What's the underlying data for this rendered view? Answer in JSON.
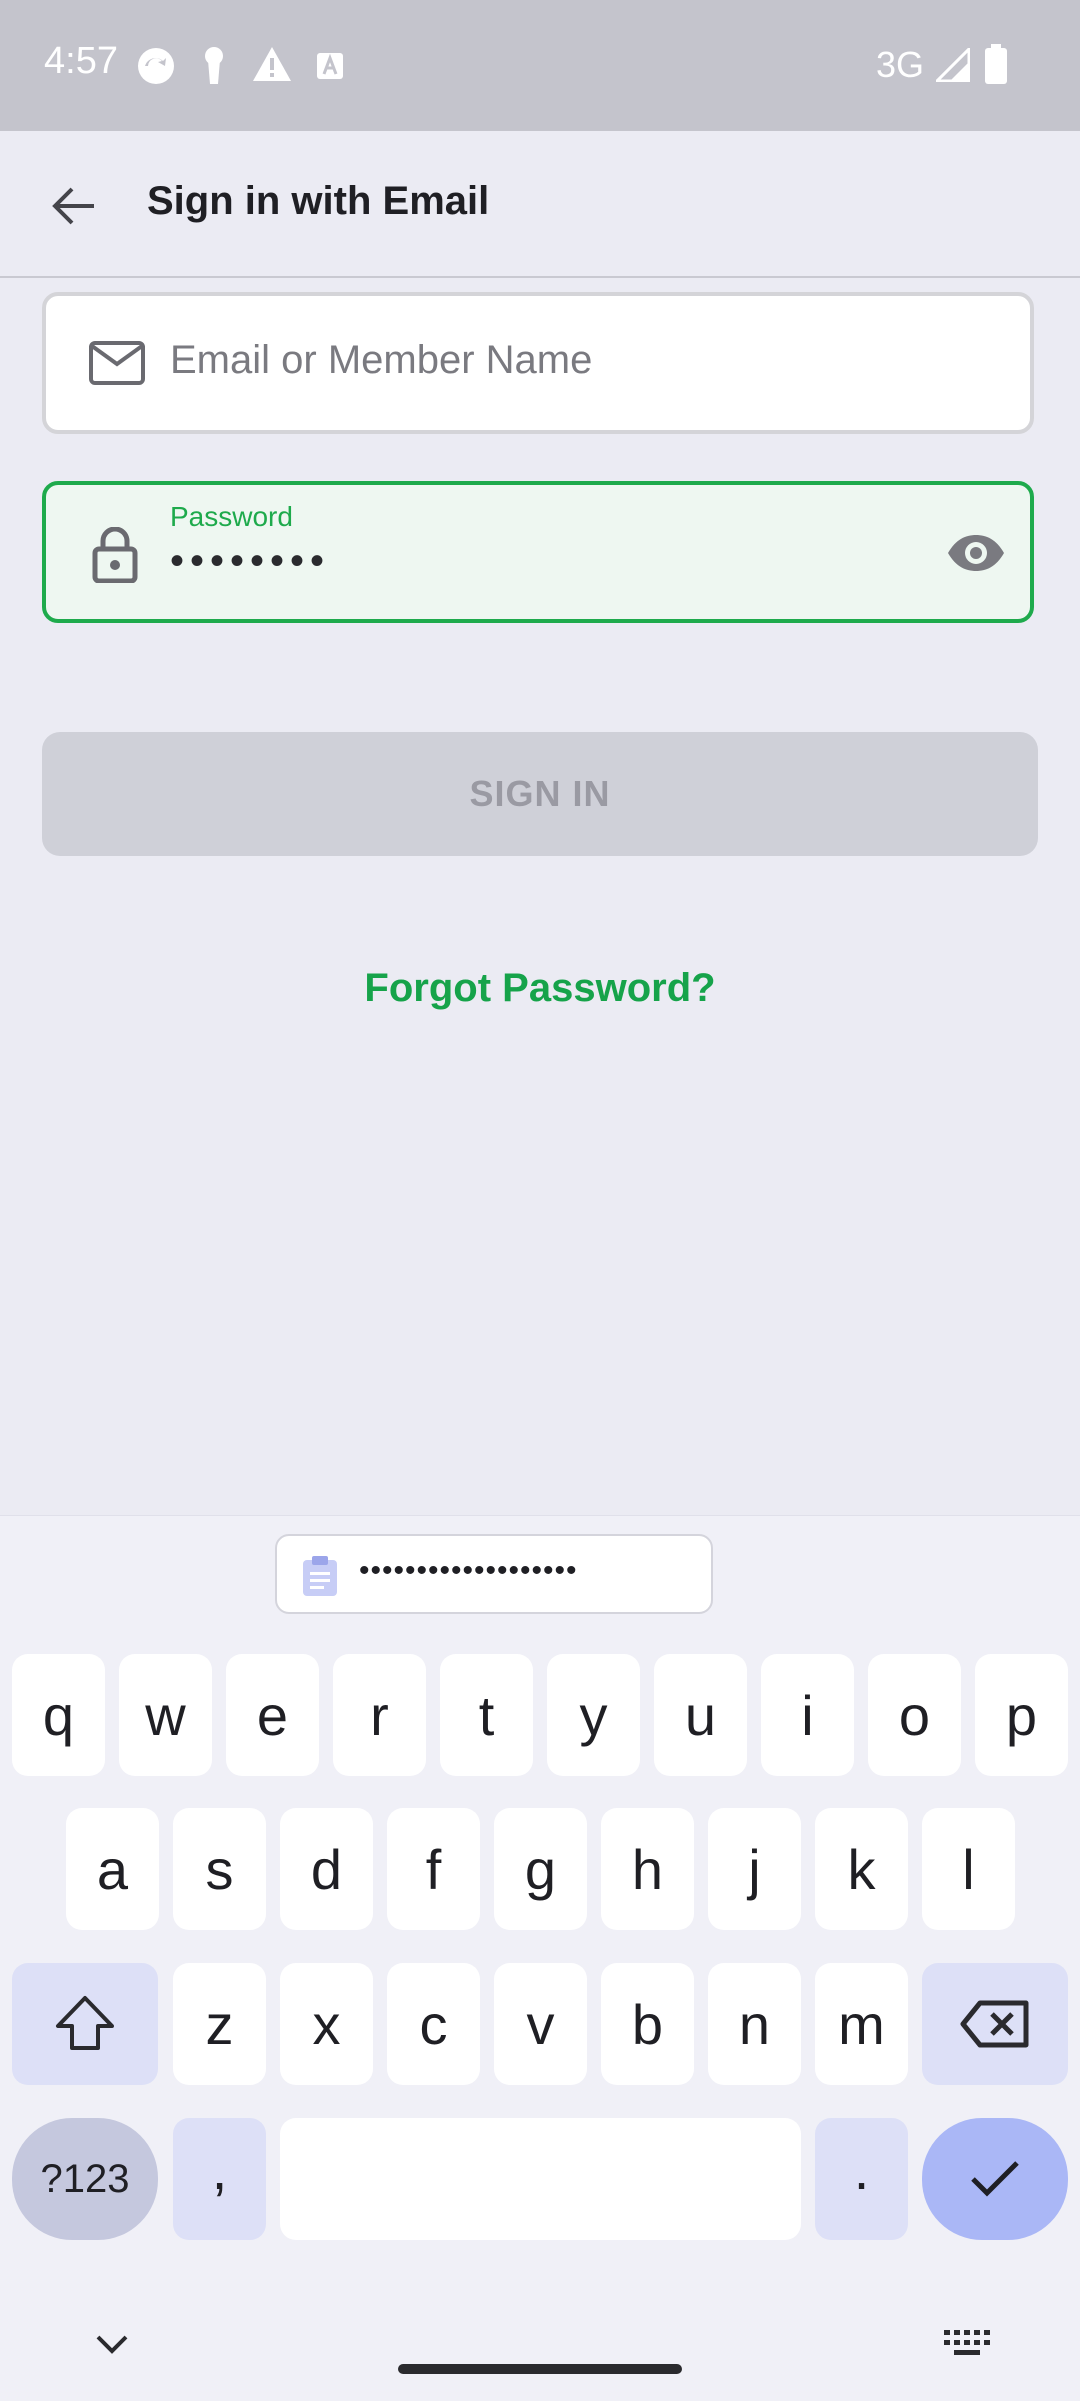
{
  "status_bar": {
    "time": "4:57",
    "network": "3G"
  },
  "app_bar": {
    "title": "Sign in with Email"
  },
  "email_field": {
    "placeholder": "Email or Member Name"
  },
  "password_field": {
    "label": "Password",
    "value": "••••••••"
  },
  "sign_in_button": {
    "label": "SIGN IN"
  },
  "forgot_link": {
    "label": "Forgot Password?"
  },
  "clipboard_suggestion": {
    "text": "•••••••••••••••••••"
  },
  "keyboard": {
    "row1": [
      "q",
      "w",
      "e",
      "r",
      "t",
      "y",
      "u",
      "i",
      "o",
      "p"
    ],
    "row2": [
      "a",
      "s",
      "d",
      "f",
      "g",
      "h",
      "j",
      "k",
      "l"
    ],
    "row3": [
      "z",
      "x",
      "c",
      "v",
      "b",
      "n",
      "m"
    ],
    "symbols_key": "?123",
    "comma_key": ",",
    "period_key": "."
  },
  "colors": {
    "accent": "#1eaa4c",
    "link": "#16a34a",
    "button_disabled": "#cfd0d8"
  },
  "icons": [
    "back-arrow-icon",
    "mail-icon",
    "lock-icon",
    "eye-icon",
    "clipboard-icon",
    "shift-icon",
    "backspace-icon",
    "checkmark-icon",
    "chevron-down-icon",
    "keyboard-icon"
  ]
}
